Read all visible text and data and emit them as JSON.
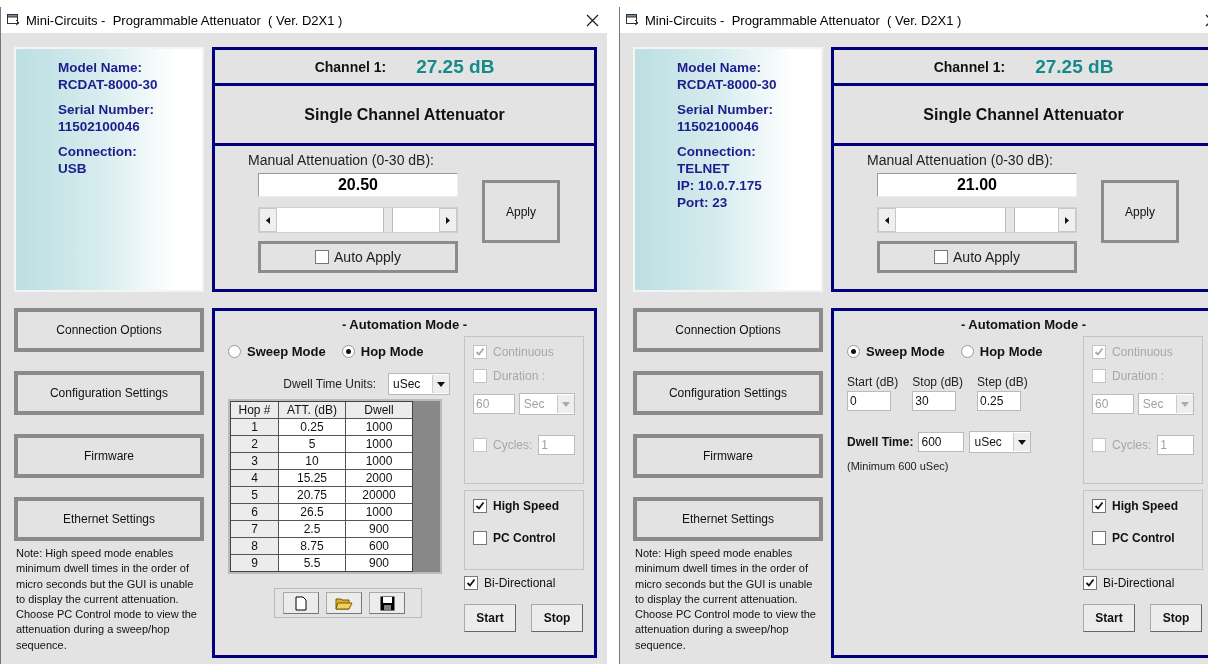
{
  "windows": [
    {
      "title": "Mini-Circuits -  Programmable Attenuator  ( Ver. D2X1 )",
      "info": [
        {
          "label": "Model Name:",
          "values": [
            "RCDAT-8000-30"
          ]
        },
        {
          "label": "Serial Number:",
          "values": [
            "11502100046"
          ]
        },
        {
          "label": "Connection:",
          "values": [
            "USB"
          ]
        }
      ],
      "channel_label": "Channel 1:",
      "channel_value": "27.25 dB",
      "device_title": "Single Channel Attenuator",
      "manual": {
        "label": "Manual Attenuation (0-30 dB):",
        "value": "20.50",
        "level": 0.68,
        "apply": "Apply",
        "auto_apply": {
          "label": "Auto Apply",
          "checked": false
        }
      },
      "side_buttons": [
        "Connection Options",
        "Configuration Settings",
        "Firmware",
        "Ethernet Settings"
      ],
      "note": "Note: High speed mode enables minimum dwell times in the order of micro seconds  but the GUI is unable to display the current attenuation. Choose PC Control mode to view the attenuation during a sweep/hop sequence.",
      "automation": {
        "title": "- Automation Mode -",
        "kind": "hop",
        "modes": [
          {
            "label": "Sweep Mode",
            "selected": false
          },
          {
            "label": "Hop Mode",
            "selected": true
          }
        ],
        "dwell_units_label": "Dwell Time Units:",
        "dwell_units": "uSec",
        "table": {
          "columns": [
            "Hop #",
            "ATT. (dB)",
            "Dwell"
          ],
          "rows": [
            [
              "1",
              "0.25",
              "1000"
            ],
            [
              "2",
              "5",
              "1000"
            ],
            [
              "3",
              "10",
              "1000"
            ],
            [
              "4",
              "15.25",
              "2000"
            ],
            [
              "5",
              "20.75",
              "20000"
            ],
            [
              "6",
              "26.5",
              "1000"
            ],
            [
              "7",
              "2.5",
              "900"
            ],
            [
              "8",
              "8.75",
              "600"
            ],
            [
              "9",
              "5.5",
              "900"
            ]
          ]
        },
        "continuous": {
          "label": "Continuous",
          "checked": true
        },
        "duration": {
          "label": "Duration :",
          "checked": false
        },
        "duration_value": "60",
        "duration_unit": "Sec",
        "cycles": {
          "label": "Cycles:",
          "checked": false
        },
        "cycles_value": "1",
        "high_speed": {
          "label": "High Speed",
          "checked": true
        },
        "pc_control": {
          "label": "PC Control",
          "checked": false
        },
        "bi_directional": {
          "label": "Bi-Directional",
          "checked": true
        },
        "start": "Start",
        "stop": "Stop"
      }
    },
    {
      "title": "Mini-Circuits -  Programmable Attenuator  ( Ver. D2X1 )",
      "info": [
        {
          "label": "Model Name:",
          "values": [
            "RCDAT-8000-30"
          ]
        },
        {
          "label": "Serial Number:",
          "values": [
            "11502100046"
          ]
        },
        {
          "label": "Connection:",
          "values": [
            "TELNET",
            "IP: 10.0.7.175",
            "Port: 23"
          ]
        }
      ],
      "channel_label": "Channel 1:",
      "channel_value": "27.25 dB",
      "device_title": "Single Channel Attenuator",
      "manual": {
        "label": "Manual Attenuation (0-30 dB):",
        "value": "21.00",
        "level": 0.7,
        "apply": "Apply",
        "auto_apply": {
          "label": "Auto Apply",
          "checked": false
        }
      },
      "side_buttons": [
        "Connection Options",
        "Configuration Settings",
        "Firmware",
        "Ethernet Settings"
      ],
      "note": "Note: High speed mode enables minimum dwell times in the order of micro seconds  but the GUI is unable to display the current attenuation. Choose PC Control mode to view the attenuation during a sweep/hop sequence.",
      "automation": {
        "title": "- Automation Mode -",
        "kind": "sweep",
        "modes": [
          {
            "label": "Sweep Mode",
            "selected": true
          },
          {
            "label": "Hop Mode",
            "selected": false
          }
        ],
        "fields": [
          {
            "label": "Start (dB)",
            "value": "0"
          },
          {
            "label": "Stop (dB)",
            "value": "30"
          },
          {
            "label": "Step (dB)",
            "value": "0.25"
          }
        ],
        "dwell_label": "Dwell Time:",
        "dwell_value": "600",
        "dwell_units": "uSec",
        "minimum_note": "(Minimum 600 uSec)",
        "continuous": {
          "label": "Continuous",
          "checked": true
        },
        "duration": {
          "label": "Duration :",
          "checked": false
        },
        "duration_value": "60",
        "duration_unit": "Sec",
        "cycles": {
          "label": "Cycles:",
          "checked": false
        },
        "cycles_value": "1",
        "high_speed": {
          "label": "High Speed",
          "checked": true
        },
        "pc_control": {
          "label": "PC Control",
          "checked": false
        },
        "bi_directional": {
          "label": "Bi-Directional",
          "checked": true
        },
        "start": "Start",
        "stop": "Stop"
      }
    }
  ]
}
